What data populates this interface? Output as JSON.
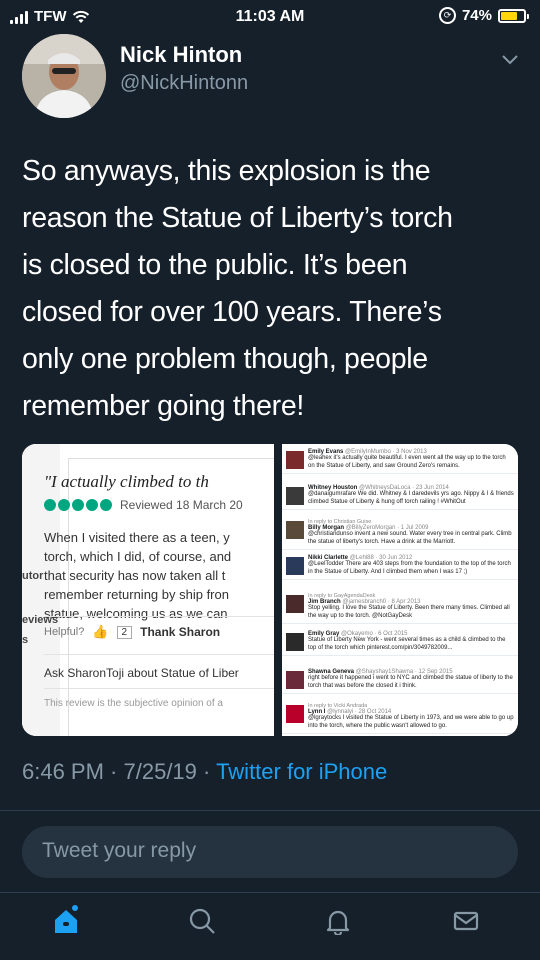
{
  "status_bar": {
    "carrier": "TFW",
    "time": "11:03 AM",
    "battery": "74%",
    "battery_level": 0.74
  },
  "author": {
    "name": "Nick Hinton",
    "handle": "@NickHintonn"
  },
  "tweet": {
    "lines": [
      "So anyways, this explosion is the",
      "reason the Statue of Liberty’s torch",
      "is closed to the public. It’s been",
      "closed for over 100 years. There’s",
      "only one problem though, people",
      "remember going there!"
    ]
  },
  "media": {
    "review": {
      "sidebar": [
        "utor",
        "eviews",
        "s"
      ],
      "title": "\"I actually climbed to th",
      "date": "Reviewed 18 March 20",
      "body": [
        "When I visited there as a teen, y",
        "torch, which I did, of course, and",
        "that security has now taken all t",
        "remember returning by ship fron",
        "statue, welcoming us as we can"
      ],
      "helpful": "Helpful?",
      "helpful_count": "2",
      "thank": "Thank Sharon",
      "ask": "Ask SharonToji about Statue of Liber",
      "disclaimer": "This review is the subjective opinion of a"
    },
    "tweets": [
      {
        "header": "Emily Evans",
        "meta": "@EmilyInMumbo · 3 Nov 2013",
        "reply": "",
        "text": "@leahex it's actually quite beautiful. I even went all the way up to the torch on the Statue of Liberty, and saw Ground Zero's remains."
      },
      {
        "header": "Whitney Houston",
        "meta": "@WhitneysDaLoca · 23 Jun 2014",
        "reply": "",
        "text": "@danaigumrafare We did. Whitney & I daredevils yrs ago. Nippy & I & friends climbed Statue of Liberty & hung off torch railing ! #WhitOut"
      },
      {
        "header": "Billy Morgan",
        "meta": "@BillyZeroMorgan · 1 Jul 2009",
        "reply": "In reply to Christian Guise",
        "text": "@christiandunso invent a new sound. Water every tree in central park. Climb the statue of liberty's torch. Have a drink at the Marriott."
      },
      {
        "header": "Nikki Clarlette",
        "meta": "@Lehl88 · 30 Jun 2012",
        "reply": "",
        "text": "@LeelTodder There are 403 steps from the foundation to the top of the torch in the Statue of Liberty. And I climbed them when I was 17 ;)"
      },
      {
        "header": "Jim Branch",
        "meta": "@jamesbranch0 · 8 Apr 2013",
        "reply": "In reply to GayAgendaDesk",
        "text": "Stop yelling. I love the Statue of Liberty. Been there many times. Climbed all the way up to the torch. @NotGayDesk"
      },
      {
        "header": "Emily Gray",
        "meta": "@Okayemo · 6 Oct 2015",
        "reply": "",
        "text": "Statue of Liberty New York - went several times as a child & climbed to the top of the torch which pinterest.com/pin/3049782009..."
      },
      {
        "header": "Shawna Geneva",
        "meta": "@Shayshay1Shawna · 12 Sep 2015",
        "reply": "",
        "text": "right before it happened i went to NYC and climbed the statue of liberty to the torch that was before the closed it i think."
      },
      {
        "header": "Lynn I",
        "meta": "@lynnalyi · 28 Oct 2014",
        "reply": "In reply to Vicki Andrada",
        "text": "@lgraytocks I visited the Statue of Liberty in 1973, and we were able to go up into the torch, where the public wasn't allowed to go."
      }
    ]
  },
  "meta": {
    "time": "6:46 PM",
    "sep1": " · ",
    "date": "7/25/19",
    "sep2": " · ",
    "source": "Twitter for iPhone"
  },
  "reply": {
    "placeholder": "Tweet your reply"
  },
  "tabbar": {
    "items": [
      "home-icon",
      "search-icon",
      "notifications-icon",
      "messages-icon"
    ],
    "accent": "#1da1f2",
    "inactive": "#8899a6"
  }
}
